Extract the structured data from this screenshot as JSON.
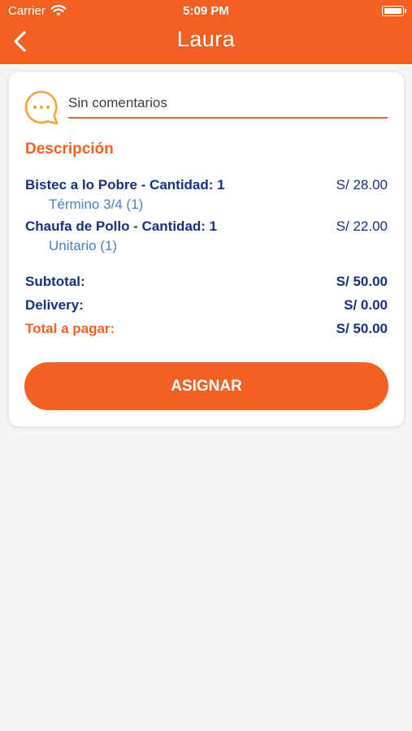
{
  "status_bar": {
    "carrier": "Carrier",
    "time": "5:09 PM"
  },
  "header": {
    "title": "Laura"
  },
  "comment": {
    "value": "",
    "placeholder": "Sin comentarios"
  },
  "description": {
    "title": "Descripción",
    "items": [
      {
        "name": "Bistec a lo Pobre - Cantidad: 1",
        "price": "S/ 28.00",
        "detail": "Término 3/4 (1)"
      },
      {
        "name": "Chaufa de Pollo - Cantidad: 1",
        "price": "S/ 22.00",
        "detail": "Unitario (1)"
      }
    ]
  },
  "totals": {
    "subtotal_label": "Subtotal:",
    "subtotal_value": "S/ 50.00",
    "delivery_label": "Delivery:",
    "delivery_value": "S/ 0.00",
    "total_label": "Total a pagar:",
    "total_value": "S/ 50.00"
  },
  "actions": {
    "assign_label": "ASIGNAR"
  },
  "colors": {
    "accent": "#f26022",
    "navy": "#17307a",
    "link_blue": "#4a80bd",
    "background": "#f5f5f5"
  }
}
